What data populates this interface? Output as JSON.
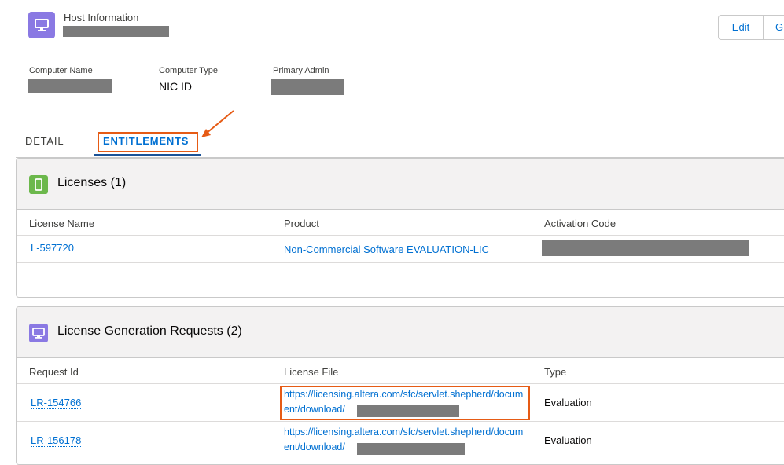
{
  "header": {
    "title": "Host Information",
    "buttons": {
      "edit": "Edit",
      "go": "G"
    }
  },
  "fields": [
    {
      "label": "Computer Name",
      "value": ""
    },
    {
      "label": "Computer Type",
      "value": "NIC ID"
    },
    {
      "label": "Primary Admin",
      "value": ""
    }
  ],
  "tabs": {
    "detail": "DETAIL",
    "entitlements": "ENTITLEMENTS"
  },
  "licenses": {
    "title": "Licenses (1)",
    "columns": [
      "License Name",
      "Product",
      "Activation Code"
    ],
    "rows": [
      {
        "name": "L-597720",
        "product": "Non-Commercial Software EVALUATION-LIC"
      }
    ]
  },
  "requests": {
    "title": "License Generation Requests (2)",
    "columns": [
      "Request Id",
      "License File",
      "Type"
    ],
    "rows": [
      {
        "id": "LR-154766",
        "file": "https://licensing.altera.com/sfc/servlet.shepherd/document/download/",
        "type": "Evaluation"
      },
      {
        "id": "LR-156178",
        "file": "https://licensing.altera.com/sfc/servlet.shepherd/document/download/",
        "type": "Evaluation"
      }
    ]
  },
  "colors": {
    "accent": "#0070d2",
    "annotation": "#e65b15",
    "host_icon": "#8a79e3",
    "license_icon": "#6cb84c"
  }
}
